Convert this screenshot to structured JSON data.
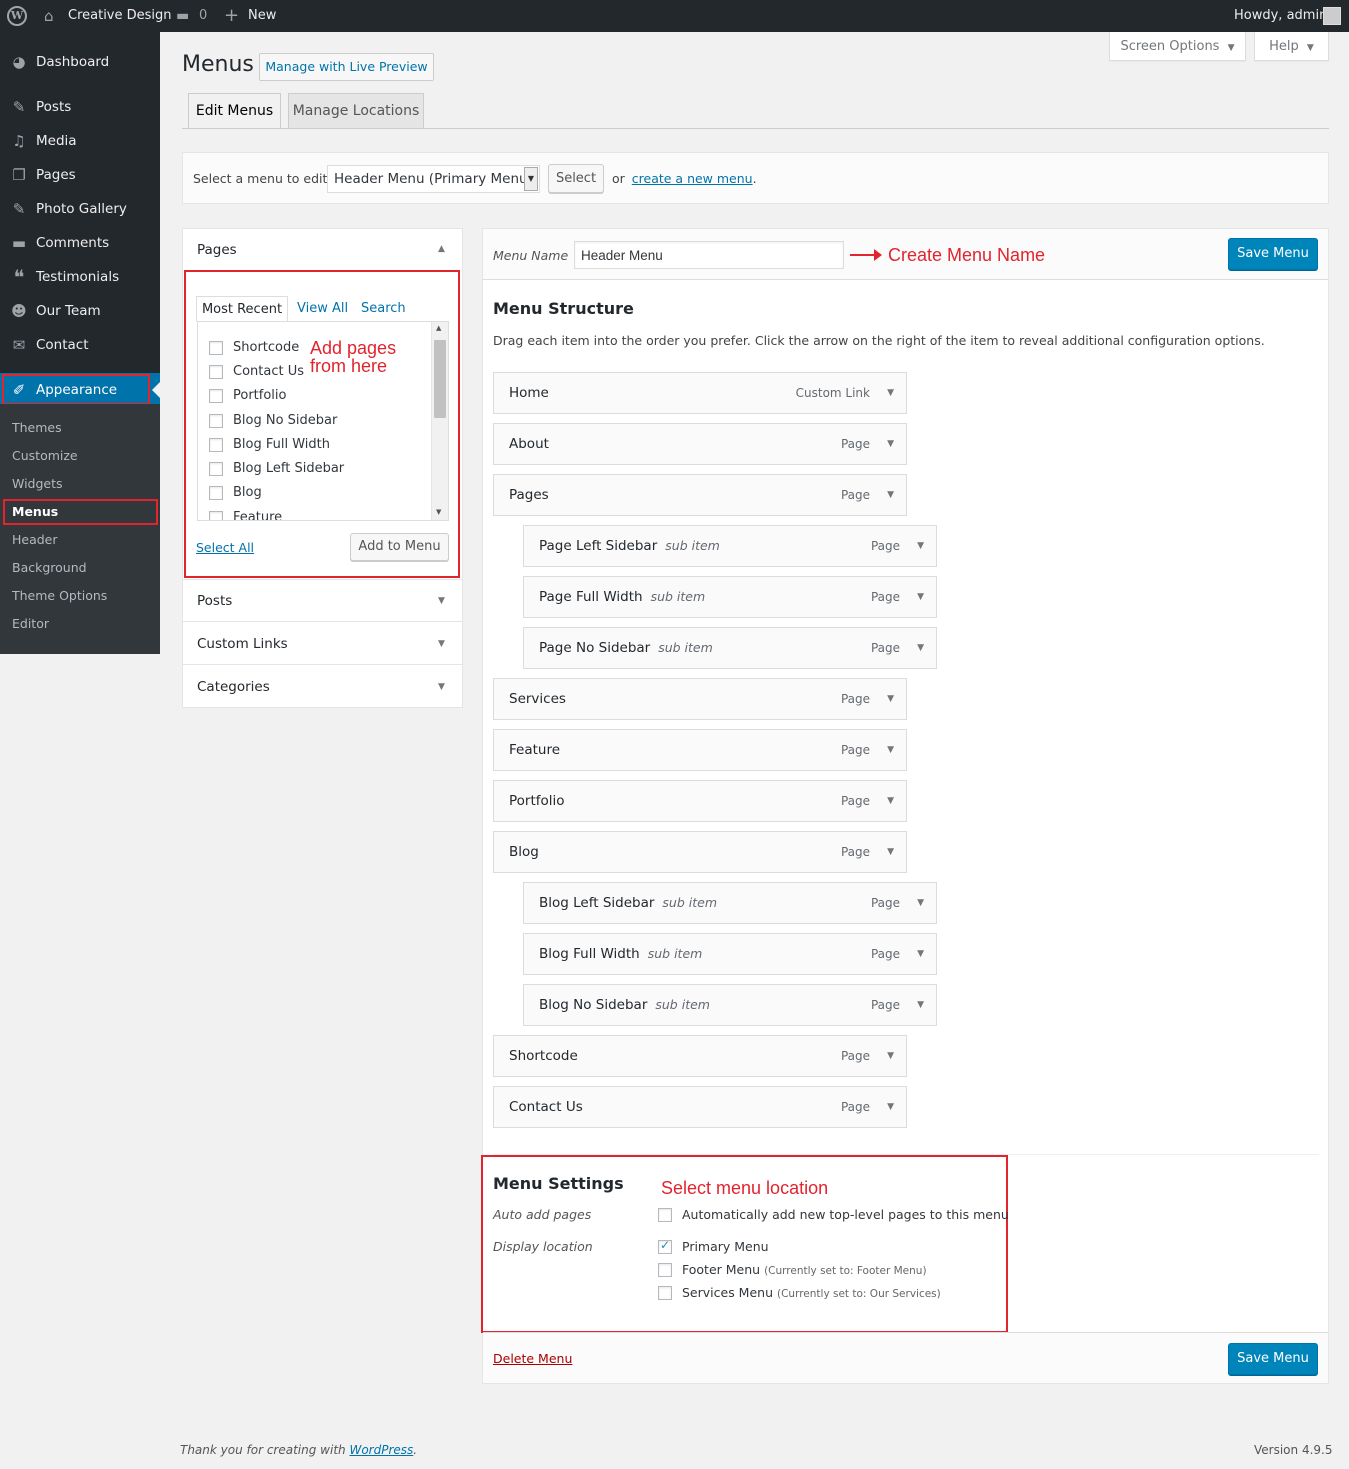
{
  "adminbar": {
    "site_name": "Creative Design",
    "comments_count": "0",
    "new_label": "New",
    "howdy": "Howdy, admin"
  },
  "sidebar": {
    "items": [
      {
        "label": "Dashboard",
        "icon": "dashboard-icon"
      },
      {
        "label": "Posts",
        "icon": "pin-icon"
      },
      {
        "label": "Media",
        "icon": "media-icon"
      },
      {
        "label": "Pages",
        "icon": "pages-icon"
      },
      {
        "label": "Photo Gallery",
        "icon": "pin-icon"
      },
      {
        "label": "Comments",
        "icon": "comment-icon"
      },
      {
        "label": "Testimonials",
        "icon": "quote-icon"
      },
      {
        "label": "Our Team",
        "icon": "team-icon"
      },
      {
        "label": "Contact",
        "icon": "envelope-icon"
      },
      {
        "label": "Appearance",
        "icon": "brush-icon"
      }
    ],
    "submenu": [
      "Themes",
      "Customize",
      "Widgets",
      "Menus",
      "Header",
      "Background",
      "Theme Options",
      "Editor"
    ]
  },
  "header": {
    "title": "Menus",
    "live_preview": "Manage with Live Preview",
    "screen_options": "Screen Options",
    "help": "Help",
    "tabs": [
      "Edit Menus",
      "Manage Locations"
    ]
  },
  "select_bar": {
    "label": "Select a menu to edit:",
    "selected": "Header Menu (Primary Menu)",
    "select_button": "Select",
    "or_text": "or",
    "create_link": "create a new menu",
    "period": "."
  },
  "accordion": {
    "pages_title": "Pages",
    "inner_tabs": [
      "Most Recent",
      "View All",
      "Search"
    ],
    "pages": [
      "Shortcode",
      "Contact Us",
      "Portfolio",
      "Blog No Sidebar",
      "Blog Full Width",
      "Blog Left Sidebar",
      "Blog",
      "Feature"
    ],
    "select_all": "Select All",
    "add_to_menu": "Add to Menu",
    "sections": [
      "Posts",
      "Custom Links",
      "Categories"
    ]
  },
  "annotations": {
    "add_pages_line1": "Add pages",
    "add_pages_line2": "from here",
    "create_name": "Create Menu Name",
    "select_location": "Select menu location"
  },
  "menu_edit": {
    "name_label": "Menu Name",
    "name_value": "Header Menu",
    "save_button": "Save Menu",
    "structure_title": "Menu Structure",
    "structure_desc": "Drag each item into the order you prefer. Click the arrow on the right of the item to reveal additional configuration options.",
    "items": [
      {
        "title": "Home",
        "type": "Custom Link",
        "sub": ""
      },
      {
        "title": "About",
        "type": "Page",
        "sub": ""
      },
      {
        "title": "Pages",
        "type": "Page",
        "sub": ""
      },
      {
        "title": "Page Left Sidebar",
        "type": "Page",
        "sub": "sub item"
      },
      {
        "title": "Page Full Width",
        "type": "Page",
        "sub": "sub item"
      },
      {
        "title": "Page No Sidebar",
        "type": "Page",
        "sub": "sub item"
      },
      {
        "title": "Services",
        "type": "Page",
        "sub": ""
      },
      {
        "title": "Feature",
        "type": "Page",
        "sub": ""
      },
      {
        "title": "Portfolio",
        "type": "Page",
        "sub": ""
      },
      {
        "title": "Blog",
        "type": "Page",
        "sub": ""
      },
      {
        "title": "Blog Left Sidebar",
        "type": "Page",
        "sub": "sub item"
      },
      {
        "title": "Blog Full Width",
        "type": "Page",
        "sub": "sub item"
      },
      {
        "title": "Blog No Sidebar",
        "type": "Page",
        "sub": "sub item"
      },
      {
        "title": "Shortcode",
        "type": "Page",
        "sub": ""
      },
      {
        "title": "Contact Us",
        "type": "Page",
        "sub": ""
      }
    ],
    "settings_title": "Menu Settings",
    "auto_add_label": "Auto add pages",
    "auto_add_text": "Automatically add new top-level pages to this menu",
    "display_location_label": "Display location",
    "locations": [
      {
        "label": "Primary Menu",
        "note": "",
        "checked": true
      },
      {
        "label": "Footer Menu",
        "note": "(Currently set to: Footer Menu)",
        "checked": false
      },
      {
        "label": "Services Menu",
        "note": "(Currently set to: Our Services)",
        "checked": false
      }
    ],
    "delete_link": "Delete Menu"
  },
  "footer": {
    "thanks": "Thank you for creating with",
    "wp_link": "WordPress",
    "period": ".",
    "version": "Version 4.9.5"
  },
  "colors": {
    "accent": "#0073aa",
    "primary_button": "#0085ba",
    "annotation_red": "#e1242d",
    "adminbar": "#23282d"
  }
}
